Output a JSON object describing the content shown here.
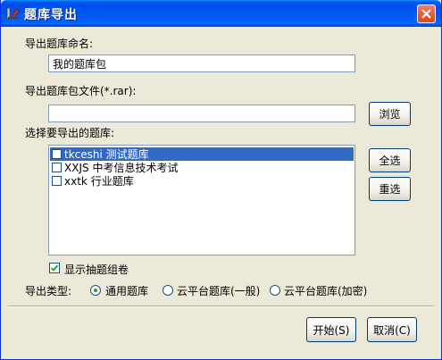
{
  "window": {
    "title": "题库导出"
  },
  "form": {
    "name_label": "导出题库命名:",
    "name_value": "我的题库包",
    "file_label": "导出题库包文件(*.rar):",
    "file_value": "",
    "browse_button": "浏览",
    "select_label": "选择要导出的题库:",
    "banks": [
      {
        "code": "tkceshi",
        "name": "测试题库",
        "checked": false,
        "selected": true
      },
      {
        "code": "XXJS",
        "name": "中考信息技术考试",
        "checked": false,
        "selected": false
      },
      {
        "code": "xxtk",
        "name": "行业题库",
        "checked": false,
        "selected": false
      }
    ],
    "select_all_button": "全选",
    "reselect_button": "重选",
    "show_extract_label": "显示抽题组卷",
    "show_extract_checked": true,
    "export_type_label": "导出类型:",
    "export_types": [
      {
        "label": "通用题库",
        "selected": true
      },
      {
        "label": "云平台题库(一般)",
        "selected": false
      },
      {
        "label": "云平台题库(加密)",
        "selected": false
      }
    ]
  },
  "footer": {
    "start_button": "开始(S)",
    "cancel_button": "取消(C)"
  },
  "colors": {
    "title_bar": "#0053ee",
    "dialog_bg": "#ece9d8",
    "selection": "#316ac5"
  }
}
